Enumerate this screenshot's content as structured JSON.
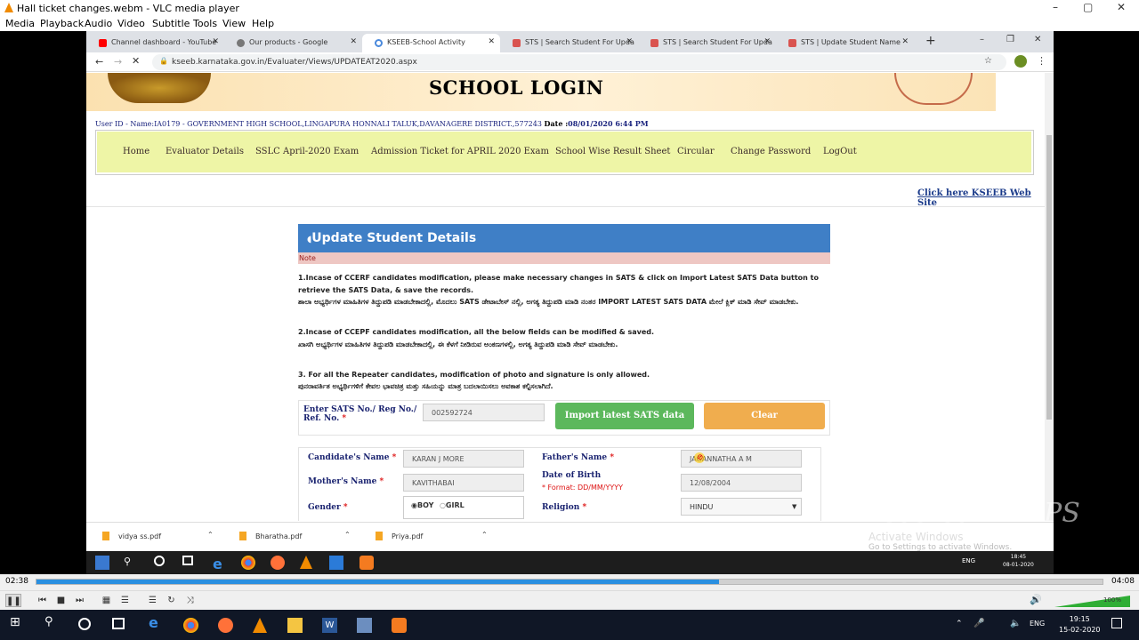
{
  "vlc": {
    "window_title": "Hall ticket changes.webm - VLC media player",
    "menu": [
      "Media",
      "Playback",
      "Audio",
      "Video",
      "Subtitle",
      "Tools",
      "View",
      "Help"
    ],
    "time_elapsed": "02:38",
    "time_total": "04:08",
    "progress": 0.64,
    "volume": "100%"
  },
  "browser": {
    "tabs": [
      {
        "label": "Channel dashboard - YouTube",
        "color": "#ff0000",
        "active": false
      },
      {
        "label": "Our products - Google",
        "color": "#777777",
        "active": false
      },
      {
        "label": "KSEEB-School Activity",
        "color": "#4a89dc",
        "active": true
      },
      {
        "label": "STS | Search Student For Upda",
        "color": "#d9534f",
        "active": false
      },
      {
        "label": "STS | Search Student For Upda",
        "color": "#d9534f",
        "active": false
      },
      {
        "label": "STS | Update Student Name",
        "color": "#d9534f",
        "active": false
      }
    ],
    "url": "kseeb.karnataka.gov.in/Evaluater/Views/UPDATEAT2020.aspx"
  },
  "page": {
    "banner_title": "SCHOOL LOGIN",
    "user_info": "User ID - Name:IA0179 - GOVERNMENT HIGH SCHOOL,LINGAPURA HONNALI TALUK,DAVANAGERE DISTRICT.,577243",
    "date_label": "Date :",
    "date_value": "08/01/2020 6:44 PM",
    "nav": [
      "Home",
      "Evaluator Details",
      "SSLC April-2020 Exam",
      "Admission Ticket for APRIL 2020 Exam",
      "School Wise Result Sheet",
      "Circular",
      "Change Password",
      "LogOut"
    ],
    "kseeb_link": "Click here KSEEB Web Site",
    "panel_title": "Update Student Details",
    "note": "Note",
    "instructions": [
      "1.Incase of CCERF candidates modification, please make necessary changes in SATS & click on Import Latest SATS Data button to retrieve the SATS Data, & save the records.",
      "ಶಾಲಾ ಅಭ್ಯರ್ಥಿಗಳ ಮಾಹಿತಿಗಳ ತಿದ್ದುಪಡಿ ಮಾಡಬೇಕಾದಲ್ಲಿ, ಮೊದಲು SATS ಡೇಟಾಬೇಸ್ ನಲ್ಲಿ, ಅಗತ್ಯ ತಿದ್ದುಪಡಿ ಮಾಡಿ ನಂತರ IMPORT LATEST SATS DATA ಮೇಲೆ ಕ್ಲಿಕ್ ಮಾಡಿ ಸೇವ್ ಮಾಡಬೇಕು.",
      "2.Incase of CCEPF candidates modification, all the below fields can be modified & saved.",
      "ಖಾಸಗಿ ಅಭ್ಯರ್ಥಿಗಳ ಮಾಹಿತಿಗಳ ತಿದ್ದುಪಡಿ ಮಾಡಬೇಕಾದಲ್ಲಿ, ಈ ಕೆಳಗೆ ನೀಡಿರುವ ಅಂಕಣಗಳಲ್ಲಿ, ಅಗತ್ಯ ತಿದ್ದುಪಡಿ ಮಾಡಿ ಸೇವ್ ಮಾಡಬೇಕು.",
      "3. For all the Repeater candidates, modification of photo and signature is only allowed.",
      "ಪುನರಾವರ್ತಿತ ಅಭ್ಯರ್ಥಿಗಳಿಗೆ ಕೇವಲ ಭಾವಚಿತ್ರ ಮತ್ತು ಸಹಿಯನ್ನು ಮಾತ್ರ ಬದಲಾಯಿಸಲು ಅವಕಾಶ ಕಲ್ಪಿಸಲಾಗಿದೆ."
    ],
    "sats_label_1": "Enter SATS No./ Reg No./",
    "sats_label_2": "Ref. No.",
    "sats_value": "002592724",
    "import_button": "Import latest SATS data",
    "clear_button": "Clear",
    "form": {
      "candidate_name_label": "Candidate's Name",
      "candidate_name": "KARAN J MORE",
      "father_name_label": "Father's Name",
      "father_name": "JAGANNATHA A M",
      "mother_name_label": "Mother's Name",
      "mother_name": "KAVITHABAI",
      "dob_label": "Date of Birth",
      "dob_format": "* Format: DD/MM/YYYY",
      "dob": "12/08/2004",
      "gender_label": "Gender",
      "gender_boy": "BOY",
      "gender_girl": "GIRL",
      "religion_label": "Religion",
      "religion": "HINDU"
    },
    "required_mark": "*"
  },
  "downloads": [
    "vidya ss.pdf",
    "Bharatha.pdf",
    "Priya.pdf"
  ],
  "activate": {
    "title": "Activate Windows",
    "subtitle": "Go to Settings to activate Windows."
  },
  "inner_tray": {
    "lang": "ENG",
    "time": "18:45",
    "date": "08-01-2020"
  },
  "taskbar": {
    "lang": "ENG",
    "time": "19:15",
    "date": "15-02-2020"
  },
  "watermark": "Icecream APPS"
}
